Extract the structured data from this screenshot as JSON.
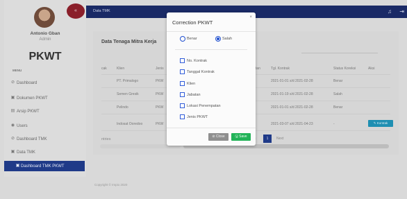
{
  "user": {
    "name": "Antonio Gban",
    "role": "Admin"
  },
  "brand": "PKWT",
  "menu_heading": "MENU",
  "collapse_glyph": "«",
  "nav": [
    {
      "label": "Dashboard",
      "icon": "dashboard-icon",
      "glyph": "⊘",
      "active": false
    },
    {
      "label": "Dokumen PKWT",
      "icon": "document-icon",
      "glyph": "▣",
      "active": false
    },
    {
      "label": "Arsip PKWT",
      "icon": "archive-icon",
      "glyph": "▤",
      "active": false
    },
    {
      "label": "Users",
      "icon": "users-icon",
      "glyph": "◉",
      "active": false
    },
    {
      "label": "Dashboard TMK",
      "icon": "dashboard-tmk-icon",
      "glyph": "⊘",
      "active": false
    },
    {
      "label": "Data TMK",
      "icon": "data-tmk-icon",
      "glyph": "▣",
      "active": false
    },
    {
      "label": "Dashboard TMK PKWT",
      "icon": "dashboard-tmk-pkwt-icon",
      "glyph": "▣",
      "active": true
    }
  ],
  "topbar": {
    "title": "Data TMK",
    "bell_glyph": "♫",
    "logout_glyph": "⇥"
  },
  "card": {
    "title": "Data Tenaga Mitra Kerja",
    "columns": [
      "cak",
      "Klien",
      "Jenis",
      "tan",
      "Tgl. Kontrak",
      "Status Koreksi",
      "Aksi"
    ],
    "rows": [
      {
        "klien": "PT. Primalogo",
        "jenis": "PKW",
        "tgl": "2021-01-01 s/d 2021-02-28",
        "status": "Benar"
      },
      {
        "klien": "Semen Gresik",
        "jenis": "PKW",
        "tgl": "2021-01-19 s/d 2021-02-28",
        "status": "Salah"
      },
      {
        "klien": "Pelindo",
        "jenis": "PKW",
        "tgl": "2021-01-01 s/d 2021-02-28",
        "status": "Benar"
      },
      {
        "klien": "Indosat Ooredoo",
        "jenis": "PKW",
        "tgl": "2021-03-07 s/d 2021-04-23",
        "status": "-"
      }
    ],
    "kontrak_button": "✎ Kontrak",
    "show_label": "ntries",
    "pagination": {
      "prev": "s",
      "current": "1",
      "next": "Next"
    }
  },
  "footer": "Copyright © Impio 2020",
  "modal": {
    "title": "Correction PKWT",
    "close_glyph": "×",
    "radios": [
      {
        "label": "Benar",
        "checked": false
      },
      {
        "label": "Salah",
        "checked": true
      }
    ],
    "checkboxes": [
      "No. Kontrak",
      "Tanggal Kontrak",
      "Klien",
      "Jabatan",
      "Lokasi Penempatan",
      "Jenis PKWT"
    ],
    "close_button": "⊘ Close",
    "save_button": "🖫 Save"
  },
  "colors": {
    "sidebar_active": "#1f3a88",
    "topbar": "#1a2a66",
    "collapse": "#8a1f2a",
    "save": "#22b358",
    "kontrak": "#1f8fb2"
  }
}
